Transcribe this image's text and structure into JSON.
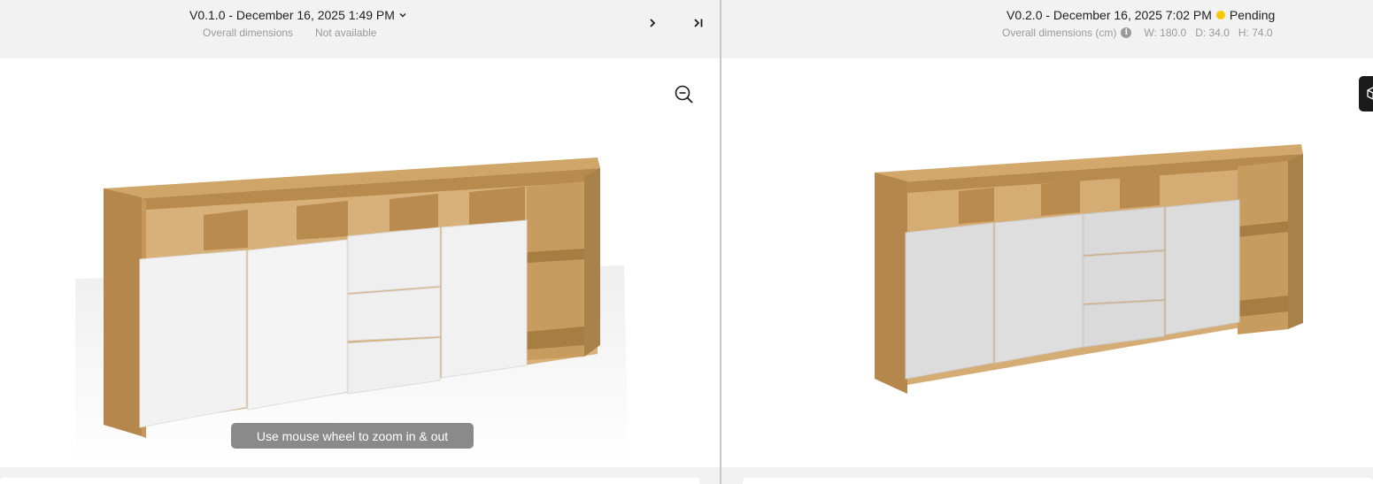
{
  "left": {
    "version_title": "V0.1.0 - December 16, 2025 1:49 PM",
    "dims_label": "Overall dimensions",
    "dims_value": "Not available",
    "tooltip": "Use mouse wheel to zoom in & out"
  },
  "right": {
    "version_title": "V0.2.0 - December 16, 2025 7:02 PM",
    "status": "Pending",
    "dims_label": "Overall dimensions (cm)",
    "width": "W: 180.0",
    "depth": "D: 34.0",
    "height": "H: 74.0"
  },
  "colors": {
    "header_bg": "#f2f2f2",
    "pending": "#f5c800",
    "tooltip_bg": "#8a8a8a",
    "oak": "#c2955a",
    "door_white": "#f2f2f2",
    "door_grey": "#dedede"
  },
  "icons": [
    "chevron-down-icon",
    "chevron-right-icon",
    "skip-to-end-icon",
    "zoom-out-icon",
    "info-icon",
    "cube-icon"
  ]
}
